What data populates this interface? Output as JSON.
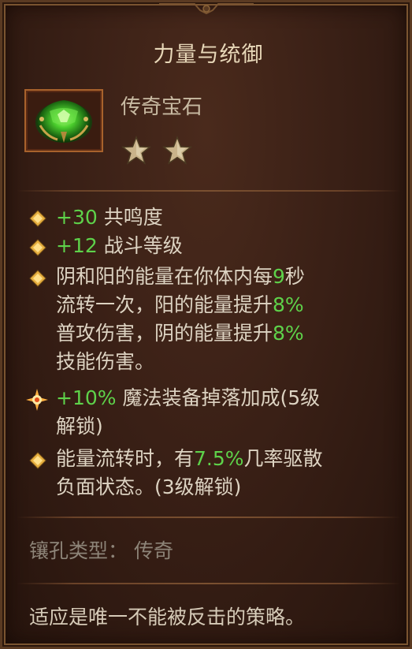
{
  "tooltip": {
    "title": "力量与统御",
    "item_type": "传奇宝石",
    "star_count": 2,
    "icon": "green-legendary-gem-icon",
    "affixes": [
      {
        "value": "+30",
        "text": " 共鸣度"
      },
      {
        "value": "+12",
        "text": " 战斗等级"
      },
      {
        "line1_a": "阴和阳的能量在你体内每",
        "line1_v": "9",
        "line1_b": "秒",
        "line2_a": "流转一次，阳的能量提升",
        "line2_v": "8%",
        "line3_a": "普攻伤害，阴的能量提升",
        "line3_v": "8%",
        "line4": "技能伤害。"
      },
      {
        "line1_v": "+10%",
        "line1_b": " 魔法装备掉落加成(5级",
        "line2": "解锁)"
      },
      {
        "line1_a": "能量流转时，有",
        "line1_v": "7.5%",
        "line1_b": "几率驱散",
        "line2": "负面状态。(3级解锁)"
      }
    ],
    "socket_label": "镶孔类型：",
    "socket_value": "传奇",
    "flavor": "适应是唯一不能被反击的策略。"
  },
  "colors": {
    "highlight_green": "#5ed24a",
    "body_text": "#ddd3c2",
    "muted_text": "#8d8478",
    "title": "#e7d7b8",
    "bullet_gold": "#e8b040"
  }
}
